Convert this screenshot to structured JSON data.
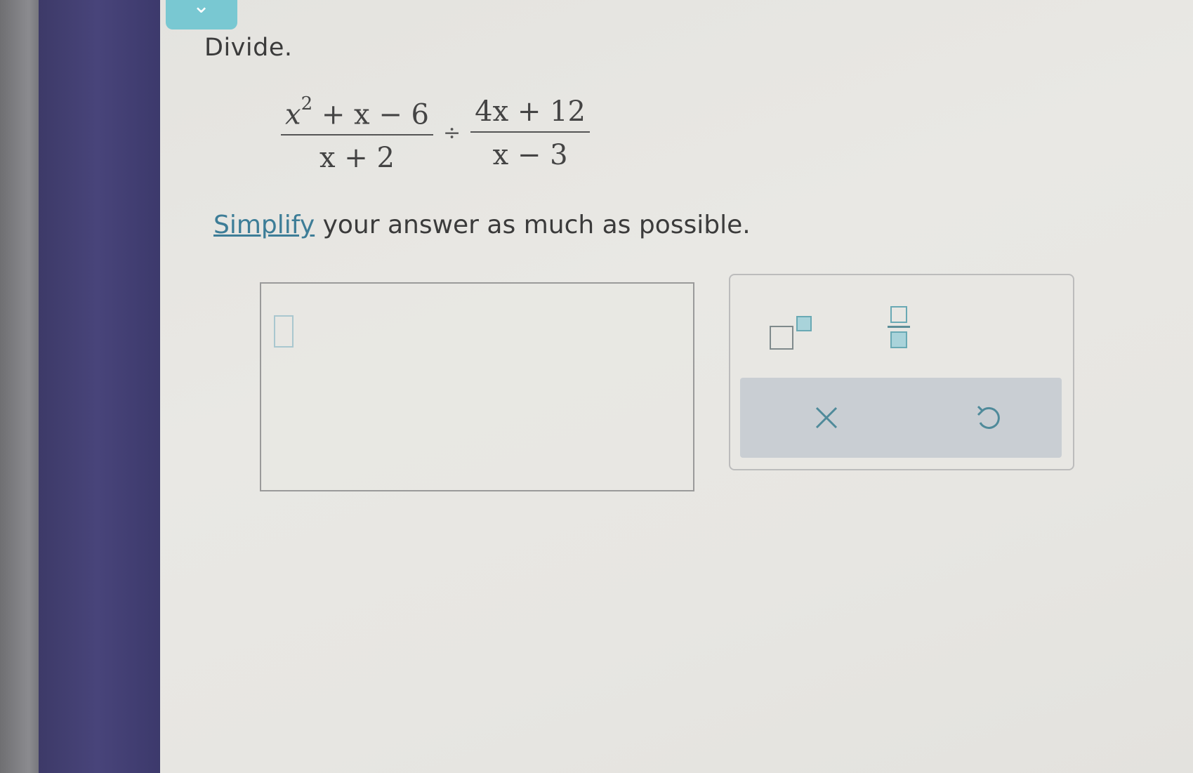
{
  "question": {
    "instruction": "Divide.",
    "expression": {
      "left_numerator_base": "x",
      "left_numerator_exponent": "2",
      "left_numerator_rest": " + x − 6",
      "left_denominator": "x + 2",
      "operator": "÷",
      "right_numerator": "4x + 12",
      "right_denominator": "x − 3"
    },
    "direction": {
      "link_text": "Simplify",
      "rest": " your answer as much as possible."
    }
  },
  "answer": {
    "value": ""
  },
  "tools": {
    "superscript": "superscript-template-icon",
    "fraction": "fraction-template-icon",
    "clear": "clear-x-icon",
    "undo": "undo-icon"
  },
  "colors": {
    "accent": "#69a9b4",
    "sidebar": "#45417a",
    "link": "#3d7d97"
  }
}
